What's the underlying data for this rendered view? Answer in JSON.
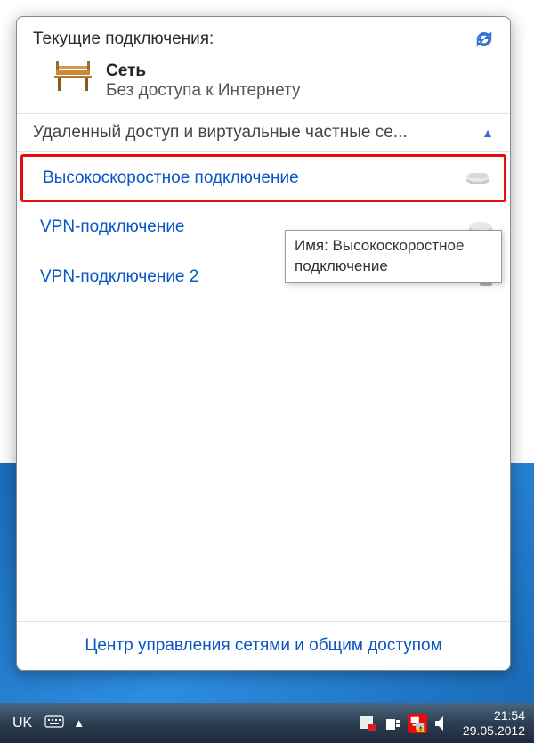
{
  "flyout": {
    "title": "Текущие подключения:",
    "network": {
      "name": "Сеть",
      "status": "Без доступа к Интернету"
    },
    "section_header": "Удаленный доступ и виртуальные частные се...",
    "connections": [
      {
        "label": "Высокоскоростное подключение",
        "icon": "modem",
        "highlighted": true
      },
      {
        "label": "VPN-подключение",
        "icon": "modem",
        "highlighted": false
      },
      {
        "label": "VPN-подключение 2",
        "icon": "server",
        "highlighted": false
      }
    ],
    "footer_link": "Центр управления сетями и общим доступом"
  },
  "tooltip": {
    "text": "Имя: Высокоскоростное подключение"
  },
  "taskbar": {
    "language": "UK",
    "time": "21:54",
    "date": "29.05.2012"
  }
}
